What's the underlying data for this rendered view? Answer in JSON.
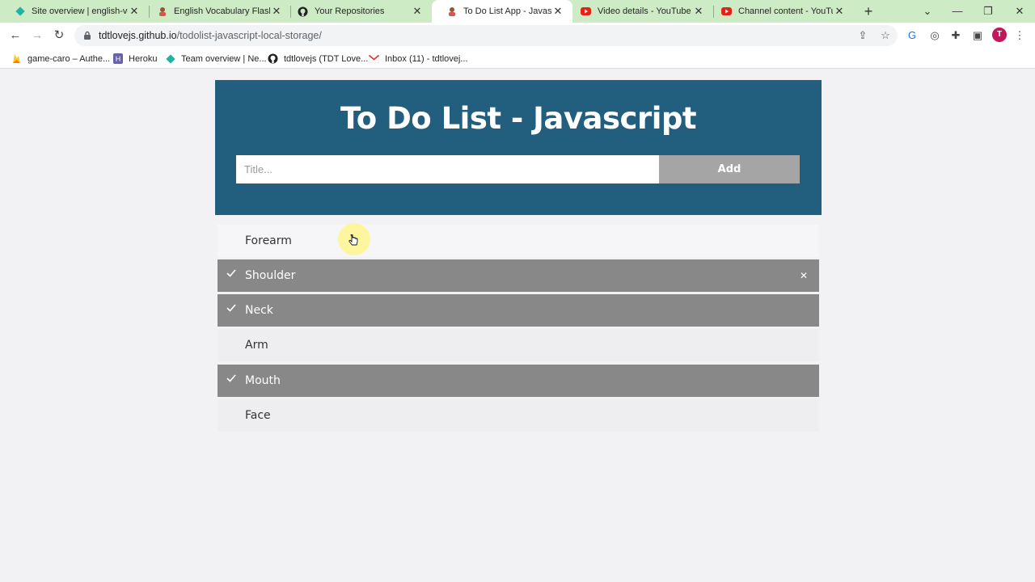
{
  "browser": {
    "tabs": [
      {
        "title": "Site overview | english-voca",
        "icon": "netlify-icon"
      },
      {
        "title": "English Vocabulary Flashcar",
        "icon": "avatar-icon"
      },
      {
        "title": "Your Repositories",
        "icon": "github-icon"
      },
      {
        "title": "To Do List App - Javascript",
        "icon": "avatar-icon",
        "active": true
      },
      {
        "title": "Video details - YouTube Stu",
        "icon": "youtube-icon"
      },
      {
        "title": "Channel content - YouTube",
        "icon": "youtube-icon"
      }
    ],
    "url_host": "tdtlovejs.github.io",
    "url_path": "/todolist-javascript-local-storage/",
    "profile_initial": "T",
    "bookmarks": [
      {
        "label": "game-caro – Authe...",
        "icon": "firebase-icon"
      },
      {
        "label": "Heroku",
        "icon": "heroku-icon"
      },
      {
        "label": "Team overview | Ne...",
        "icon": "netlify-icon"
      },
      {
        "label": "tdtlovejs (TDT Love...",
        "icon": "github-icon"
      },
      {
        "label": "Inbox (11) - tdtlovej...",
        "icon": "gmail-icon"
      }
    ]
  },
  "app": {
    "title": "To Do List - Javascript",
    "input_placeholder": "Title...",
    "add_label": "Add",
    "items": [
      {
        "text": "Forearm",
        "done": false
      },
      {
        "text": "Shoulder",
        "done": true
      },
      {
        "text": "Neck",
        "done": true
      },
      {
        "text": "Arm",
        "done": false
      },
      {
        "text": "Mouth",
        "done": true
      },
      {
        "text": "Face",
        "done": false
      }
    ]
  },
  "colors": {
    "header": "#225e7e",
    "add_button": "#a5a5a5",
    "done_item": "#888888",
    "tabbar": "#cdebc4"
  }
}
